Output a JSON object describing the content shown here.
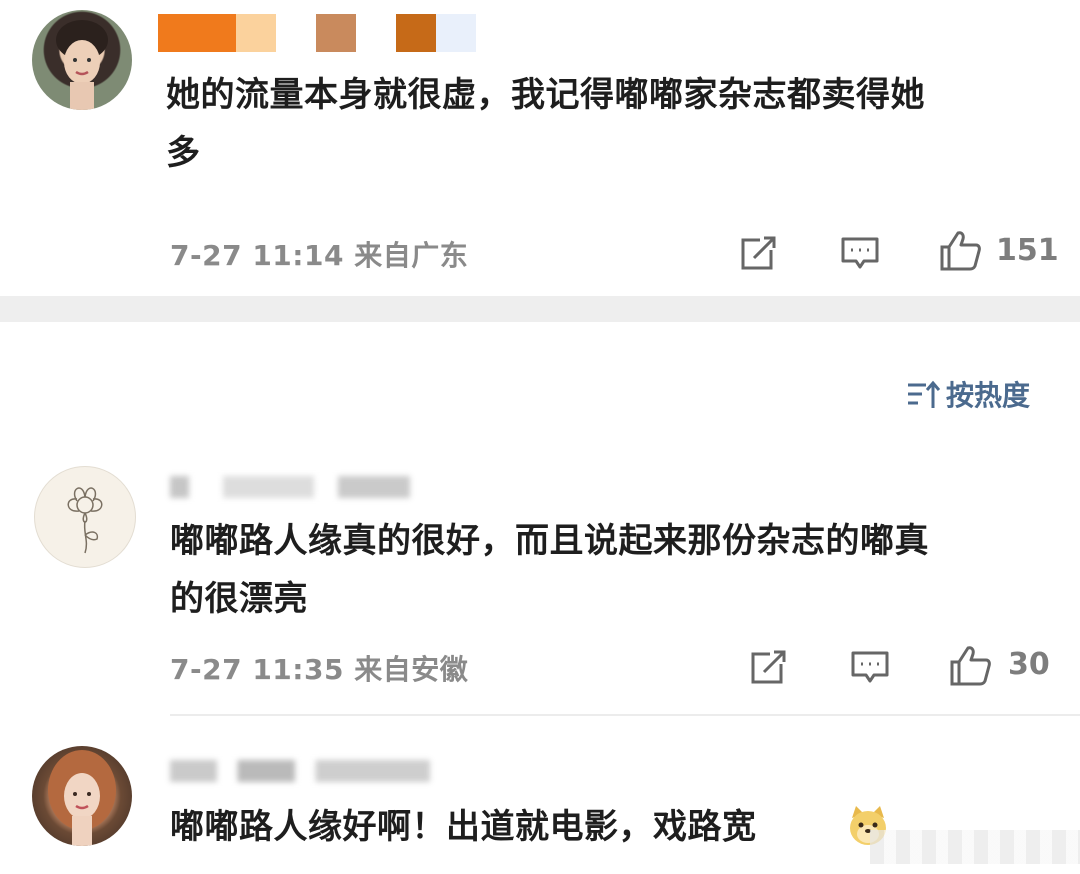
{
  "comments": [
    {
      "avatar": "avatar-photo-woman-1",
      "text_line1": "她的流量本身就很虚，我记得嘟嘟家杂志都卖得她",
      "text_line2": "多",
      "meta": "7-27 11:14 来自广东",
      "likes": "151"
    },
    {
      "avatar": "avatar-flower-sketch",
      "text_line1": "嘟嘟路人缘真的很好，而且说起来那份杂志的嘟真",
      "text_line2": "的很漂亮",
      "meta": "7-27 11:35 来自安徽",
      "likes": "30"
    },
    {
      "avatar": "avatar-photo-woman-2",
      "text_line1": "嘟嘟路人缘好啊！出道就电影，戏路宽"
    }
  ],
  "sort": {
    "label": "按热度",
    "icon": "sort-icon"
  },
  "icons": [
    "share-icon",
    "comment-icon",
    "like-icon",
    "doge-emoji-icon"
  ],
  "colors": {
    "sort_accent": "#4b6a8e",
    "meta_gray": "#8a8a8a",
    "divider": "#eeeeee"
  }
}
